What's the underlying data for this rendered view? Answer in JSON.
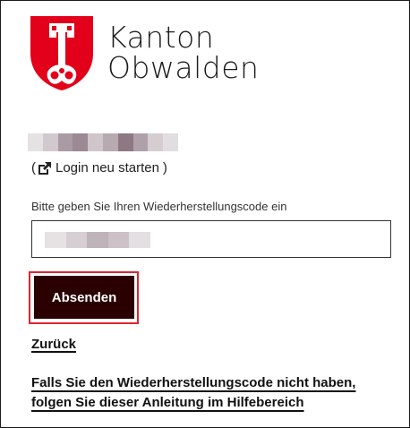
{
  "brand": {
    "line1": "Kanton",
    "line2": "Obwalden",
    "colors": {
      "crest_red": "#e2001a",
      "key_white": "#ffffff"
    }
  },
  "user": {
    "name_obscured": true,
    "blur_colors": [
      "#e6e2e4",
      "#d2c9ce",
      "#aa9aa3",
      "#9c8993",
      "#cfc5ca",
      "#b7aab1",
      "#8e7884",
      "#b0a0a9",
      "#d6cdd1",
      "#e2dde0"
    ]
  },
  "restart": {
    "open_paren": "(",
    "icon": "external-edit-icon",
    "label": "Login neu starten",
    "close_paren": ")"
  },
  "form": {
    "label": "Bitte geben Sie Ihren Wiederherstellungscode ein",
    "input_value_obscured": true,
    "input_blur_colors": [
      "#e6e2e4",
      "#d7ced3",
      "#bfb3ba",
      "#cbc1c6",
      "#e4dfe2"
    ],
    "submit_label": "Absenden",
    "submit_color": "#2b0000",
    "focus_ring_color": "#e0252e"
  },
  "links": {
    "back": "Zurück",
    "help_line1": "Falls Sie den Wiederherstellungscode nicht haben,",
    "help_line2": "folgen Sie dieser Anleitung im Hilfebereich"
  }
}
